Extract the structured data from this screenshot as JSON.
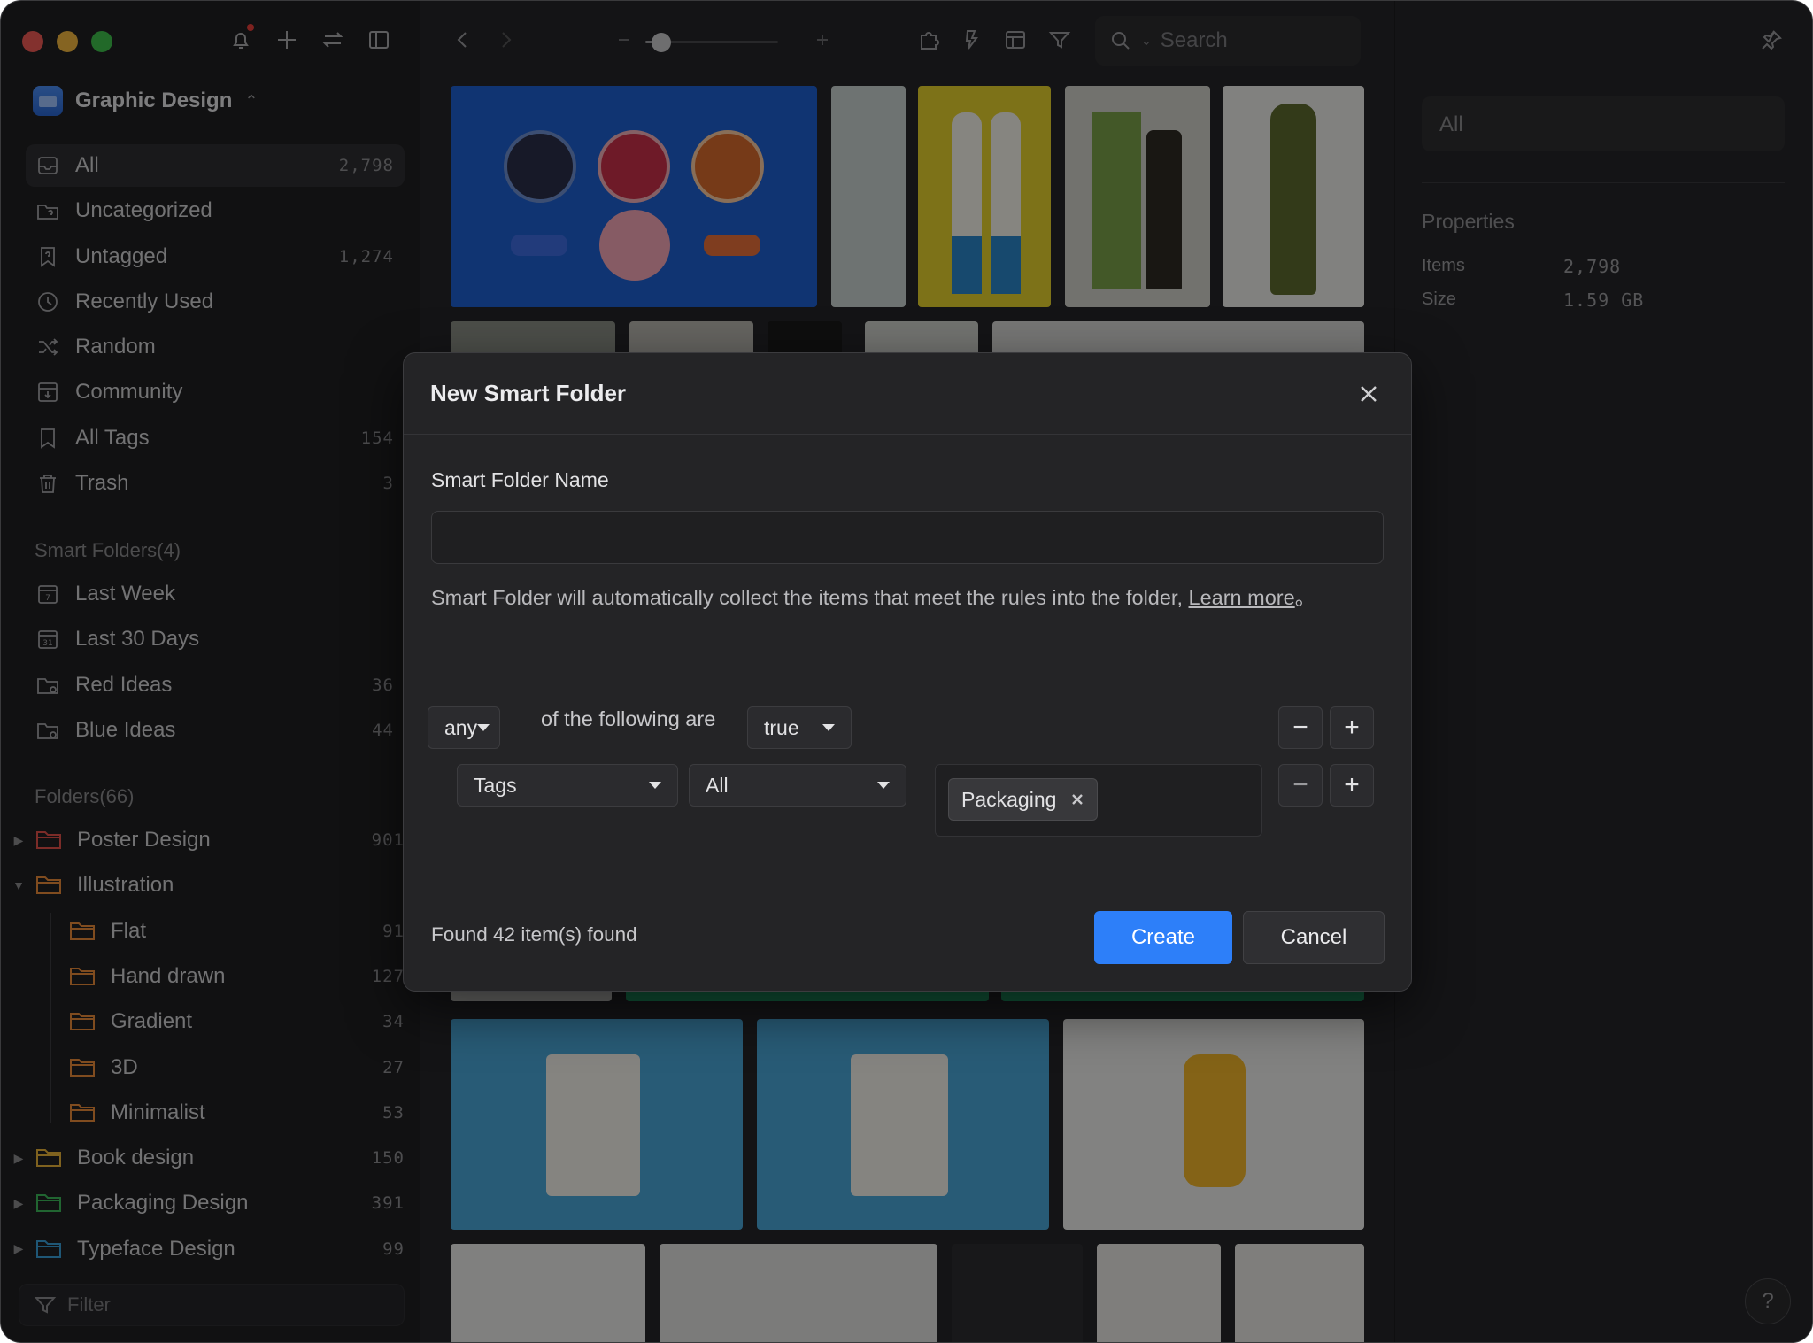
{
  "sidebar": {
    "library_name": "Graphic Design",
    "library_chevron": "⌃⌄",
    "nav": [
      {
        "label": "All",
        "count": "2,798",
        "icon": "inbox-icon"
      },
      {
        "label": "Uncategorized",
        "count": "",
        "icon": "folder-question-icon"
      },
      {
        "label": "Untagged",
        "count": "1,274",
        "icon": "tag-question-icon"
      },
      {
        "label": "Recently Used",
        "count": "",
        "icon": "clock-icon"
      },
      {
        "label": "Random",
        "count": "",
        "icon": "shuffle-icon"
      },
      {
        "label": "Community",
        "count": "",
        "icon": "download-box-icon"
      },
      {
        "label": "All Tags",
        "count": "154",
        "icon": "bookmark-icon"
      },
      {
        "label": "Trash",
        "count": "3",
        "icon": "trash-icon"
      }
    ],
    "smart_folders_title": "Smart Folders(4)",
    "smart_folders": [
      {
        "label": "Last Week",
        "count": "",
        "icon": "calendar-7-icon",
        "day": "7"
      },
      {
        "label": "Last 30 Days",
        "count": "",
        "icon": "calendar-31-icon",
        "day": "31"
      },
      {
        "label": "Red Ideas",
        "count": "36",
        "icon": "smart-folder-icon"
      },
      {
        "label": "Blue Ideas",
        "count": "44",
        "icon": "smart-folder-icon"
      }
    ],
    "folders_title": "Folders(66)",
    "folders": [
      {
        "label": "Poster Design",
        "count": "901",
        "color": "#e0504a",
        "caret": "▶",
        "indent": false
      },
      {
        "label": "Illustration",
        "count": "",
        "color": "#e98a3a",
        "caret": "▼",
        "indent": false
      },
      {
        "label": "Flat",
        "count": "91",
        "color": "#e98a3a",
        "caret": "",
        "indent": true
      },
      {
        "label": "Hand drawn",
        "count": "127",
        "color": "#e98a3a",
        "caret": "",
        "indent": true
      },
      {
        "label": "Gradient",
        "count": "34",
        "color": "#e98a3a",
        "caret": "",
        "indent": true
      },
      {
        "label": "3D",
        "count": "27",
        "color": "#e98a3a",
        "caret": "",
        "indent": true
      },
      {
        "label": "Minimalist",
        "count": "53",
        "color": "#e98a3a",
        "caret": "",
        "indent": true
      },
      {
        "label": "Book design",
        "count": "150",
        "color": "#e8b23a",
        "caret": "▶",
        "indent": false
      },
      {
        "label": "Packaging Design",
        "count": "391",
        "color": "#3cb95a",
        "caret": "▶",
        "indent": false
      },
      {
        "label": "Typeface Design",
        "count": "99",
        "color": "#3a9fd8",
        "caret": "▶",
        "indent": false
      }
    ],
    "filter_placeholder": "Filter"
  },
  "toolbar": {
    "search_placeholder": "Search",
    "zoom_level": 0.12
  },
  "right_panel": {
    "filter_value": "All",
    "properties_title": "Properties",
    "items_label": "Items",
    "items_value": "2,798",
    "size_label": "Size",
    "size_value": "1.59 GB",
    "help_label": "?"
  },
  "modal": {
    "title": "New Smart Folder",
    "name_label": "Smart Folder Name",
    "name_value": "",
    "info_text": "Smart Folder will automatically collect the items that meet the rules into the folder, ",
    "learn_more": "Learn more",
    "info_suffix": "。",
    "match_mode": "any",
    "rule_text": "of the following are",
    "truth_value": "true",
    "rule_field": "Tags",
    "rule_operator": "All",
    "tag_chip": "Packaging",
    "minus": "−",
    "plus": "+",
    "found_text": "Found 42 item(s) found",
    "create_label": "Create",
    "cancel_label": "Cancel"
  },
  "colors": {
    "accent": "#2d7ff9",
    "sidebar_bg": "#1f1f21",
    "window_bg": "#262628"
  }
}
